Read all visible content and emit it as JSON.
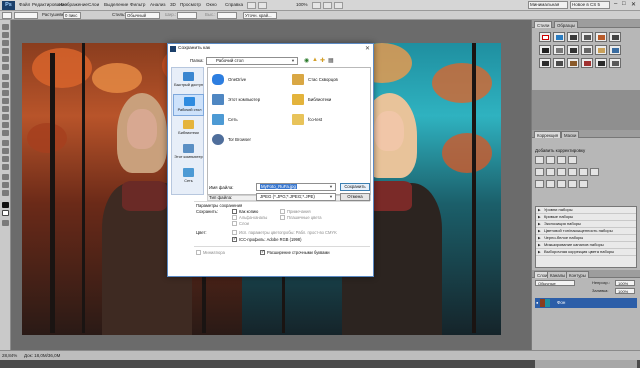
{
  "app": {
    "logo": "Ps"
  },
  "menubar": {
    "items": [
      "Файл",
      "Редактирование",
      "Изображение",
      "Слои",
      "Выделение",
      "Фильтр",
      "Анализ",
      "3D",
      "Просмотр",
      "Окно",
      "Справка"
    ],
    "zoom": "100%",
    "workspace_label": "Минимальная",
    "cs_label": "Новое в CS 5"
  },
  "options": {
    "feather_label": "Растушевка:",
    "feather_value": "0 пикс",
    "style_label": "Стиль:",
    "style_value": "Обычный",
    "width_label": "Шир.:",
    "height_label": "Выс.:",
    "refine_label": "Уточн. край..."
  },
  "status": {
    "zoom": "28,84%",
    "doc": "Док: 18,0M/36,0M"
  },
  "panels": {
    "tabs_top": [
      "Стили",
      "Образцы"
    ],
    "tabs_mid": [
      "Коррекция",
      "Маски"
    ],
    "adj_title": "Добавить корректировку",
    "presets": [
      "Уровни наборы",
      "Кривые наборы",
      "Экспозиция наборы",
      "Цветовой тон/насыщенность наборы",
      "Черно-белое наборы",
      "Микширование каналов наборы",
      "Выборочная коррекция цвета наборы"
    ],
    "tabs_layers": [
      "Слои",
      "Каналы",
      "Контуры"
    ],
    "blend_mode": "Обычные",
    "opacity_label": "Непрозр.:",
    "opacity": "100%",
    "fill_label": "Заливка:",
    "fill": "100%",
    "layer_name": "Фон"
  },
  "dialog": {
    "title": "Сохранить как",
    "folder_label": "Папка:",
    "folder_value": "Рабочий стол",
    "places": [
      {
        "label": "Быстрый доступ",
        "icon": "star-icon",
        "color": "#3a86d0"
      },
      {
        "label": "Рабочий стол",
        "icon": "desktop-icon",
        "color": "#2e8be0"
      },
      {
        "label": "Библиотеки",
        "icon": "library-icon",
        "color": "#e5b43c"
      },
      {
        "label": "Этот компьютер",
        "icon": "computer-icon",
        "color": "#5a8fc4"
      },
      {
        "label": "Сеть",
        "icon": "network-icon",
        "color": "#4d9ad4"
      }
    ],
    "files": [
      {
        "label": "OneDrive",
        "icon": "onedrive-icon",
        "color": "#2d7ee0"
      },
      {
        "label": "Стас Скворцов",
        "icon": "user-folder-icon",
        "color": "#d9a744"
      },
      {
        "label": "Этот компьютер",
        "icon": "computer-icon",
        "color": "#4f87c2"
      },
      {
        "label": "Библиотеки",
        "icon": "library-icon",
        "color": "#e3b33c"
      },
      {
        "label": "Сеть",
        "icon": "network-icon",
        "color": "#4d9ad4"
      },
      {
        "label": "fco-test",
        "icon": "folder-icon",
        "color": "#e8c35a"
      },
      {
        "label": "Tor Browser",
        "icon": "browser-icon",
        "color": "#4f6e9b"
      }
    ],
    "filename_label": "Имя файла:",
    "filename_value": "MyFoto_RuFa.jpg",
    "filetype_label": "Тип файла:",
    "filetype_value": "JPEG (*.JPG;*.JPEG;*.JPE)",
    "save_btn": "Сохранить",
    "cancel_btn": "Отмена",
    "params_title": "Параметры сохранения",
    "save_label": "Сохранить:",
    "opt_copy": "Как копию",
    "opt_notes": "Примечания",
    "opt_alpha": "Альфа-каналы",
    "opt_spot": "Плашечные цвета",
    "opt_layers": "Слои",
    "color_label": "Цвет:",
    "opt_proof": "Исп. параметры цветопробы: Рабл. прост-во CMYK",
    "opt_icc": "ICC-профиль: Adobe RGB (1998)",
    "opt_thumb": "Миниатюра",
    "opt_ext": "Расширение строчными буквами"
  }
}
